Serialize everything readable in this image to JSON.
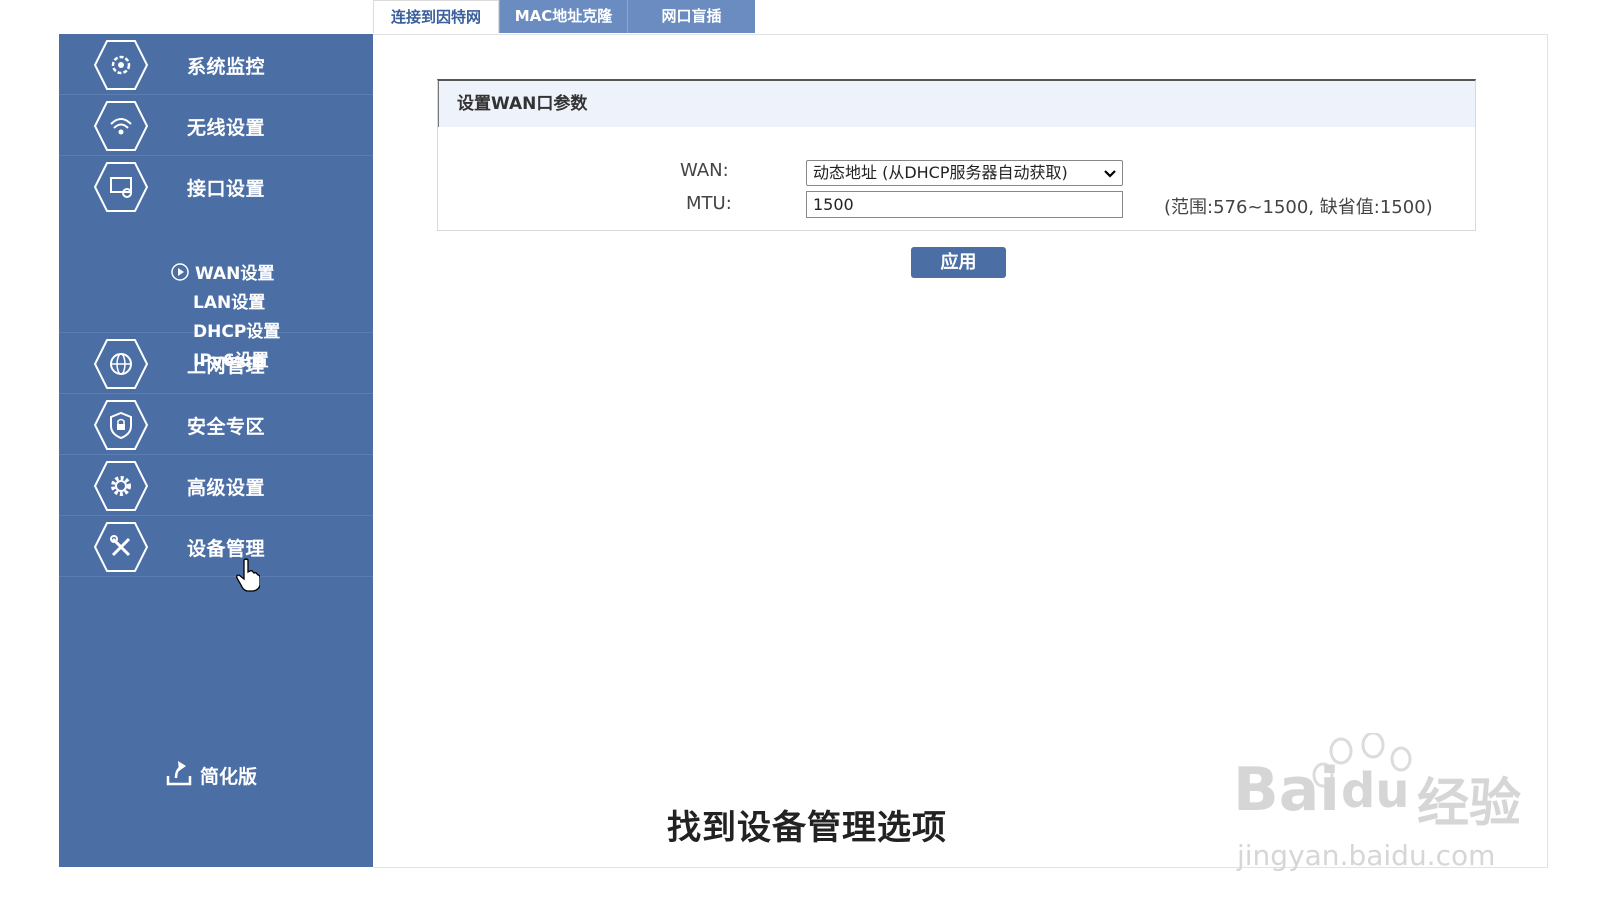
{
  "tabs": [
    {
      "label": "连接到因特网",
      "active": true
    },
    {
      "label": "MAC地址克隆",
      "active": false
    },
    {
      "label": "网口盲插",
      "active": false
    }
  ],
  "sidebar": {
    "items": [
      {
        "label": "系统监控",
        "icon": "monitor-gear-icon"
      },
      {
        "label": "无线设置",
        "icon": "wifi-icon"
      },
      {
        "label": "接口设置",
        "icon": "interface-icon"
      },
      {
        "label": "上网管理",
        "icon": "globe-icon"
      },
      {
        "label": "安全专区",
        "icon": "shield-lock-icon"
      },
      {
        "label": "高级设置",
        "icon": "gear-icon"
      },
      {
        "label": "设备管理",
        "icon": "tools-icon"
      }
    ],
    "subitems": [
      {
        "label": "WAN设置",
        "selected": true
      },
      {
        "label": "LAN设置",
        "selected": false
      },
      {
        "label": "DHCP设置",
        "selected": false
      },
      {
        "label": "IPv6设置",
        "selected": false
      }
    ],
    "simplify_label": "简化版"
  },
  "panel": {
    "title": "设置WAN口参数",
    "wan_label": "WAN:",
    "wan_value": "动态地址 (从DHCP服务器自动获取)",
    "mtu_label": "MTU:",
    "mtu_value": "1500",
    "mtu_hint": "(范围:576~1500, 缺省值:1500)",
    "apply_label": "应用"
  },
  "subtitle": "找到设备管理选项",
  "watermark": {
    "brand": "Bai",
    "brand2": "du",
    "cn": "经验",
    "url": "jingyan.baidu.com"
  },
  "colors": {
    "sidebar": "#4b6ea5",
    "tab_inactive": "#6a8cc0",
    "button": "#4b6ea5"
  }
}
